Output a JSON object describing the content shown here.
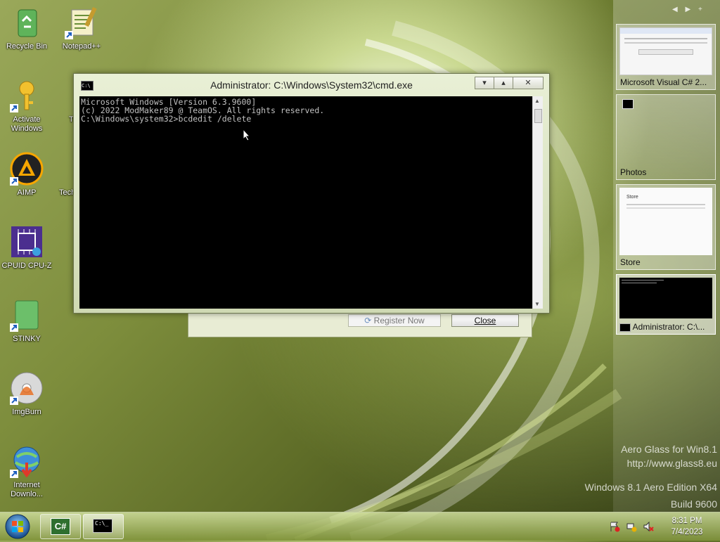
{
  "desktop": {
    "icons": [
      {
        "label": "Recycle Bin"
      },
      {
        "label": "Notepad++"
      },
      {
        "label": "Activate Windows"
      },
      {
        "label": "AIMP"
      },
      {
        "label": "CPUID CPU-Z"
      },
      {
        "label": "STINKY"
      },
      {
        "label": "ImgBurn"
      },
      {
        "label": "Internet Downlo..."
      },
      {
        "label": "T"
      },
      {
        "label": "Tech"
      }
    ],
    "watermark": {
      "line1": "Aero Glass for Win8.1",
      "line2": "http://www.glass8.eu",
      "line3": "Windows 8.1 Aero Edition X64",
      "line4": "Build 9600"
    }
  },
  "cmd_window": {
    "title": "Administrator: C:\\Windows\\System32\\cmd.exe",
    "icon": "cmd-icon",
    "minimize": "▾",
    "maximize": "▴",
    "close": "✕",
    "lines": [
      "Microsoft Windows [Version 6.3.9600]",
      "(c) 2022 ModMaker89 @ TeamOS. All rights reserved.",
      "",
      "C:\\Windows\\system32>bcdedit /delete"
    ]
  },
  "background_dialog": {
    "register_label": "Register Now",
    "close_label": "Close"
  },
  "switcher": {
    "nav": [
      "◀",
      "▶",
      "+"
    ],
    "thumbs": [
      {
        "caption": "Microsoft Visual C# 2..."
      },
      {
        "caption": "Photos"
      },
      {
        "caption": "Store"
      },
      {
        "caption": "Administrator: C:\\..."
      }
    ]
  },
  "taskbar": {
    "clock_time": "8:31 PM",
    "clock_date": "7/4/2023",
    "apps": [
      {
        "name": "csharp-app",
        "glyph": "C#"
      },
      {
        "name": "cmd-app",
        "glyph": "C:\\_"
      }
    ]
  },
  "colors": {
    "terminal_bg": "#000000",
    "terminal_fg": "#c0c0c0",
    "accent": "#8fa33f"
  }
}
